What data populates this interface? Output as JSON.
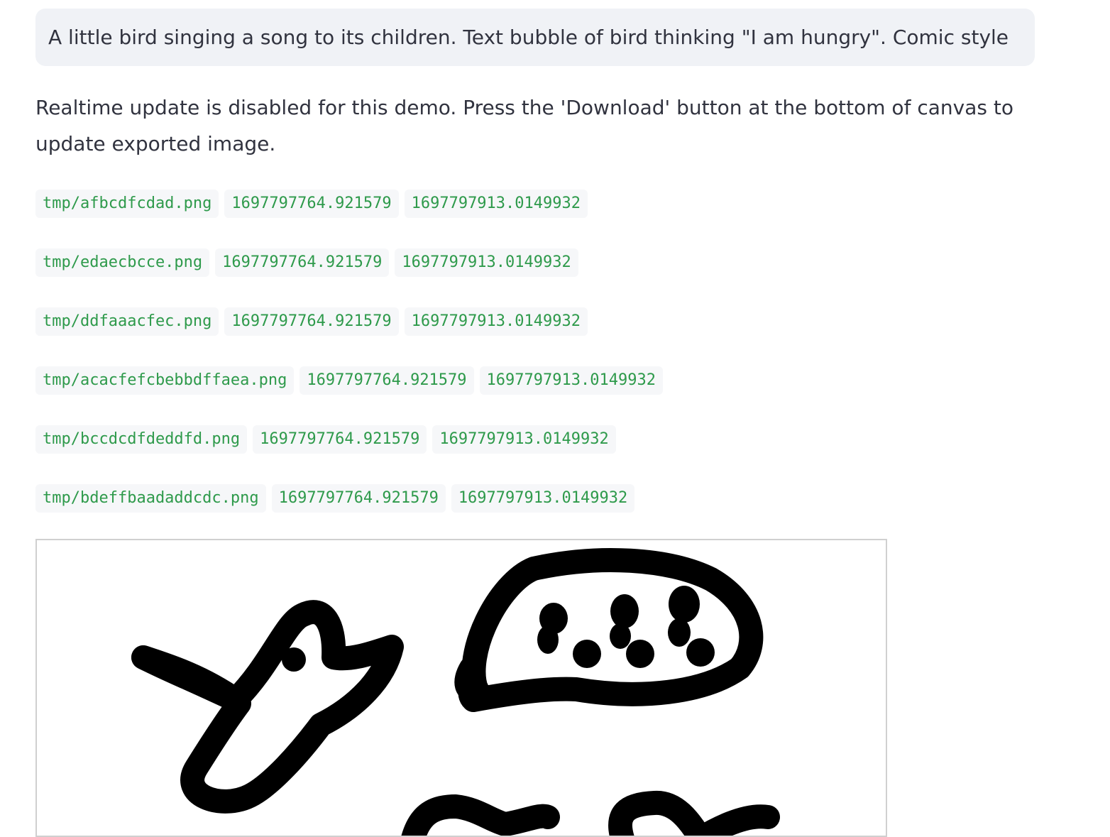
{
  "prompt": {
    "text": "A little bird singing a song to its children. Text bubble of bird thinking \"I am hungry\". Comic style"
  },
  "info": {
    "text": "Realtime update is disabled for this demo. Press the 'Download' button at the bottom of canvas to update exported image."
  },
  "files": [
    {
      "path": "tmp/afbcdfcdad.png",
      "t1": "1697797764.921579",
      "t2": "1697797913.0149932"
    },
    {
      "path": "tmp/edaecbcce.png",
      "t1": "1697797764.921579",
      "t2": "1697797913.0149932"
    },
    {
      "path": "tmp/ddfaaacfec.png",
      "t1": "1697797764.921579",
      "t2": "1697797913.0149932"
    },
    {
      "path": "tmp/acacfefcbebbdffaea.png",
      "t1": "1697797764.921579",
      "t2": "1697797913.0149932"
    },
    {
      "path": "tmp/bccdcdfdeddfd.png",
      "t1": "1697797764.921579",
      "t2": "1697797913.0149932"
    },
    {
      "path": "tmp/bdeffbaadaddcdc.png",
      "t1": "1697797764.921579",
      "t2": "1697797913.0149932"
    }
  ],
  "canvas": {
    "stroke_color": "#000000",
    "background_color": "#ffffff"
  }
}
